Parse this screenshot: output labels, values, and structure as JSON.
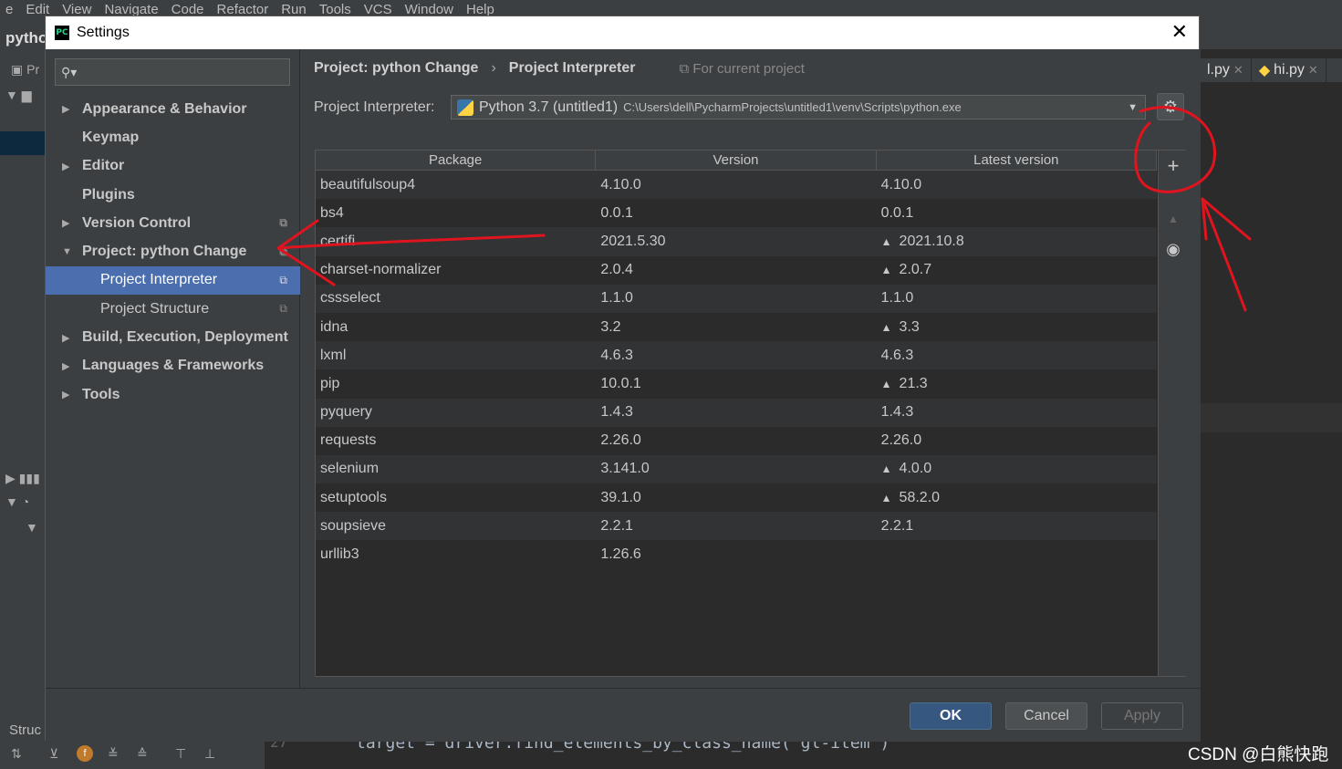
{
  "ide": {
    "menu": [
      "e",
      "Edit",
      "View",
      "Navigate",
      "Code",
      "Refactor",
      "Run",
      "Tools",
      "VCS",
      "Window",
      "Help"
    ],
    "project_title": "pytho",
    "left_panel_label": "Pr",
    "structure_label": "Struc",
    "tabs": [
      "l.py",
      "hi.py"
    ],
    "line_number": "27",
    "code_line": "target = driver.find_elements_by_class_name('gl-item')"
  },
  "watermark": "CSDN @白熊快跑",
  "dialog": {
    "title": "Settings",
    "search_placeholder": "",
    "tree": [
      {
        "label": "Appearance & Behavior",
        "arrow": "▶",
        "bold": true
      },
      {
        "label": "Keymap",
        "arrow": "",
        "bold": true
      },
      {
        "label": "Editor",
        "arrow": "▶",
        "bold": true
      },
      {
        "label": "Plugins",
        "arrow": "",
        "bold": true
      },
      {
        "label": "Version Control",
        "arrow": "▶",
        "bold": true,
        "copy": true
      },
      {
        "label": "Project: python Change",
        "arrow": "▼",
        "bold": true,
        "copy": true
      },
      {
        "label": "Project Interpreter",
        "arrow": "",
        "child": true,
        "active": true,
        "copy": true
      },
      {
        "label": "Project Structure",
        "arrow": "",
        "child": true,
        "copy": true
      },
      {
        "label": "Build, Execution, Deployment",
        "arrow": "▶",
        "bold": true
      },
      {
        "label": "Languages & Frameworks",
        "arrow": "▶",
        "bold": true
      },
      {
        "label": "Tools",
        "arrow": "▶",
        "bold": true
      }
    ],
    "breadcrumb": {
      "project": "Project: python Change",
      "separator": "›",
      "page": "Project Interpreter",
      "scope": "For current project"
    },
    "interpreter": {
      "label": "Project Interpreter:",
      "name": "Python 3.7 (untitled1)",
      "path": "C:\\Users\\dell\\PycharmProjects\\untitled1\\venv\\Scripts\\python.exe"
    },
    "table": {
      "columns": [
        "Package",
        "Version",
        "Latest version"
      ],
      "rows": [
        {
          "package": "beautifulsoup4",
          "version": "4.10.0",
          "latest": "4.10.0",
          "upgrade": false
        },
        {
          "package": "bs4",
          "version": "0.0.1",
          "latest": "0.0.1",
          "upgrade": false
        },
        {
          "package": "certifi",
          "version": "2021.5.30",
          "latest": "2021.10.8",
          "upgrade": true
        },
        {
          "package": "charset-normalizer",
          "version": "2.0.4",
          "latest": "2.0.7",
          "upgrade": true
        },
        {
          "package": "cssselect",
          "version": "1.1.0",
          "latest": "1.1.0",
          "upgrade": false
        },
        {
          "package": "idna",
          "version": "3.2",
          "latest": "3.3",
          "upgrade": true
        },
        {
          "package": "lxml",
          "version": "4.6.3",
          "latest": "4.6.3",
          "upgrade": false
        },
        {
          "package": "pip",
          "version": "10.0.1",
          "latest": "21.3",
          "upgrade": true
        },
        {
          "package": "pyquery",
          "version": "1.4.3",
          "latest": "1.4.3",
          "upgrade": false
        },
        {
          "package": "requests",
          "version": "2.26.0",
          "latest": "2.26.0",
          "upgrade": false
        },
        {
          "package": "selenium",
          "version": "3.141.0",
          "latest": "4.0.0",
          "upgrade": true
        },
        {
          "package": "setuptools",
          "version": "39.1.0",
          "latest": "58.2.0",
          "upgrade": true
        },
        {
          "package": "soupsieve",
          "version": "2.2.1",
          "latest": "2.2.1",
          "upgrade": false
        },
        {
          "package": "urllib3",
          "version": "1.26.6",
          "latest": "",
          "upgrade": false
        }
      ]
    },
    "buttons": {
      "ok": "OK",
      "cancel": "Cancel",
      "apply": "Apply"
    },
    "help": "?"
  },
  "colors": {
    "accent_selection": "#4b6eaf",
    "ok_button": "#365880",
    "annotation": "#e0141e"
  }
}
